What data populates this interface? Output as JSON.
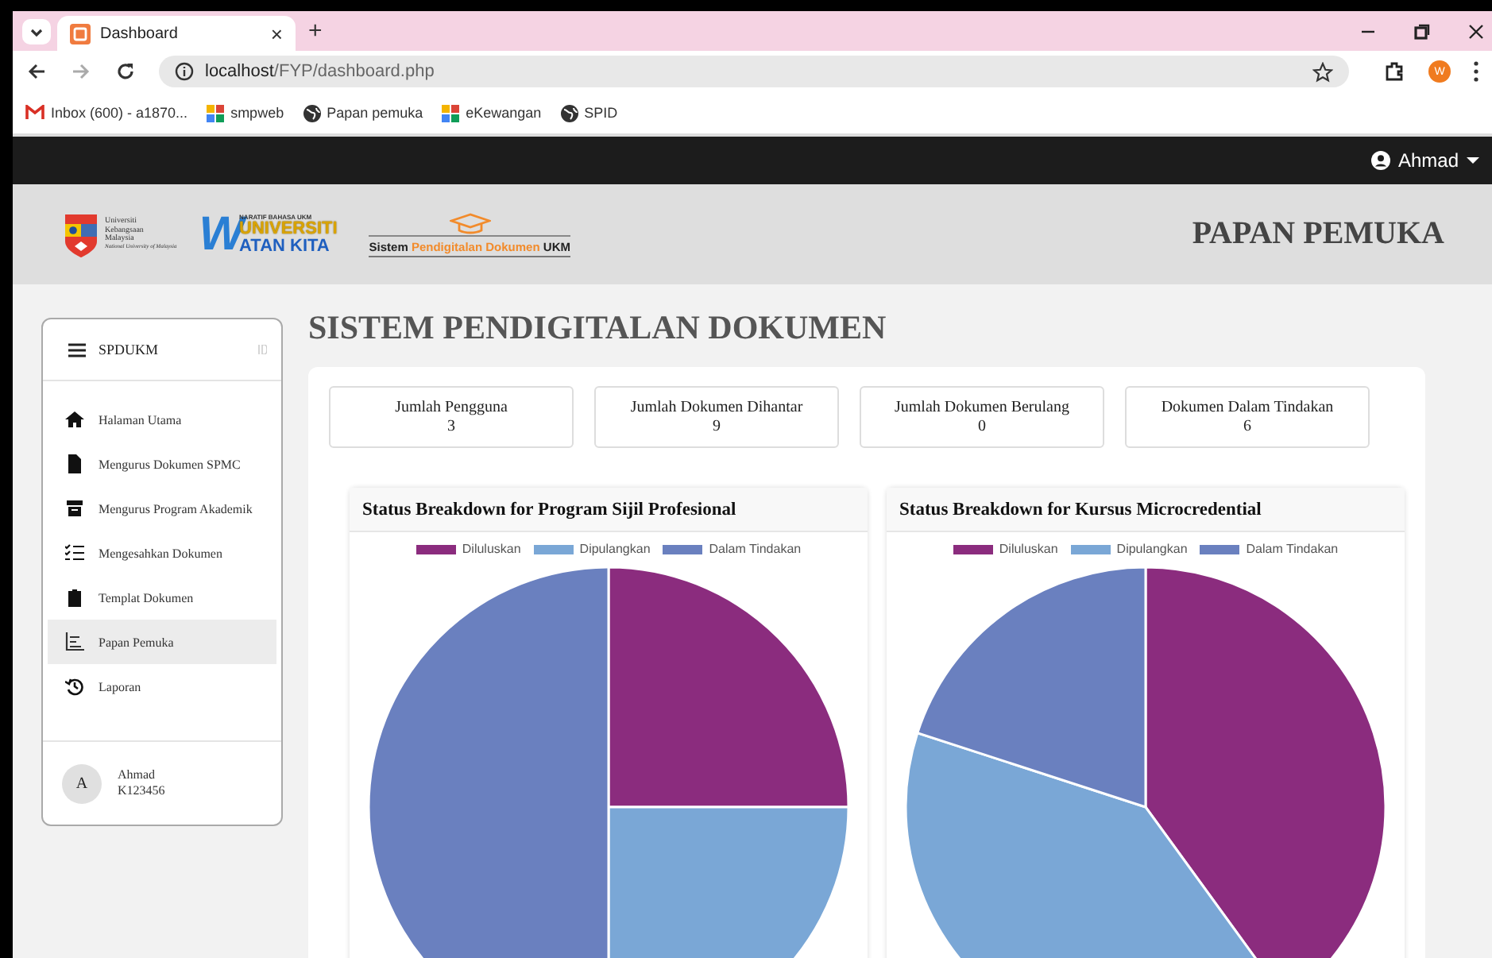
{
  "browser": {
    "tab": {
      "title": "Dashboard",
      "close": "×"
    },
    "new_tab": "+",
    "address": {
      "host": "localhost",
      "path": "/FYP/dashboard.php"
    },
    "profile": "W",
    "bookmarks": [
      {
        "label": "Inbox (600) - a1870...",
        "kind": "mail"
      },
      {
        "label": "smpweb",
        "kind": "app"
      },
      {
        "label": "Papan pemuka",
        "kind": "globe"
      },
      {
        "label": "eKewangan",
        "kind": "app"
      },
      {
        "label": "SPID",
        "kind": "globe"
      }
    ]
  },
  "navbar": {
    "user": "Ahmad"
  },
  "header": {
    "ukm_logo_lines": [
      "Universiti",
      "Kebangsaan",
      "Malaysia"
    ],
    "ukm_logo_sub": "National University of Malaysia",
    "watan_logo": {
      "initial": "W",
      "tagline": "NARATIF BAHASA UKM",
      "line1": "UNIVERSITI",
      "line2": "ATAN KITA"
    },
    "spd_logo": {
      "part1": "Sistem",
      "part2": "Pendigitalan Dokumen",
      "part3": "UKM"
    },
    "title": "PAPAN PEMUKA"
  },
  "sidebar": {
    "brand": "SPDUKM",
    "items": [
      {
        "label": "Halaman Utama",
        "kind": "home",
        "selected": false
      },
      {
        "label": "Mengurus Dokumen SPMC",
        "kind": "file",
        "selected": false
      },
      {
        "label": "Mengurus Program Akademik",
        "kind": "archive",
        "selected": false
      },
      {
        "label": "Mengesahkan Dokumen",
        "kind": "checklist",
        "selected": false
      },
      {
        "label": "Templat Dokumen",
        "kind": "clipboard",
        "selected": false
      },
      {
        "label": "Papan Pemuka",
        "kind": "chart",
        "selected": true
      },
      {
        "label": "Laporan",
        "kind": "history",
        "selected": false
      }
    ],
    "user": {
      "initial": "A",
      "name": "Ahmad",
      "id": "K123456"
    }
  },
  "page_title": "SISTEM PENDIGITALAN DOKUMEN",
  "stats": [
    {
      "label": "Jumlah Pengguna",
      "value": "3"
    },
    {
      "label": "Jumlah Dokumen Dihantar",
      "value": "9"
    },
    {
      "label": "Jumlah Dokumen Berulang",
      "value": "0"
    },
    {
      "label": "Dokumen Dalam Tindakan",
      "value": "6"
    }
  ],
  "charts": [
    {
      "chart_data": {
        "type": "pie",
        "title": "Status Breakdown for Program Sijil Profesional",
        "legend": "top",
        "categories": [
          "Diluluskan",
          "Dipulangkan",
          "Dalam Tindakan"
        ],
        "values": [
          25,
          25,
          50
        ],
        "colors": [
          "#8b2c7e",
          "#7aa7d6",
          "#6a80bf"
        ]
      }
    },
    {
      "chart_data": {
        "type": "pie",
        "title": "Status Breakdown for Kursus Microcredential",
        "legend": "top",
        "categories": [
          "Diluluskan",
          "Dipulangkan",
          "Dalam Tindakan"
        ],
        "values": [
          40,
          40,
          20
        ],
        "colors": [
          "#8b2c7e",
          "#7aa7d6",
          "#6a80bf"
        ]
      }
    }
  ]
}
